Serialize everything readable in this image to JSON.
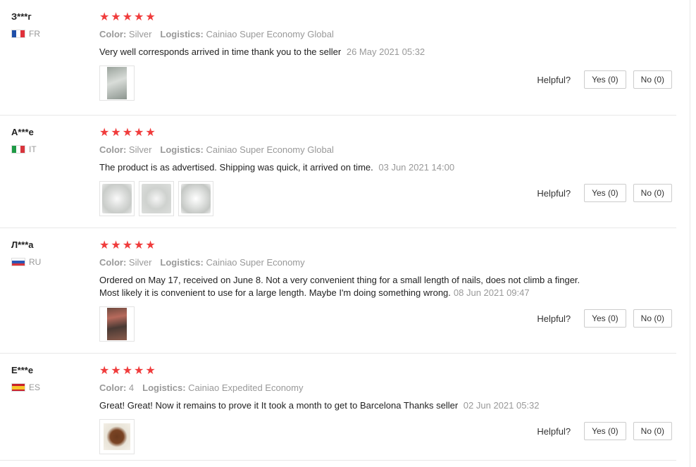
{
  "helpful_label": "Helpful?",
  "color_label": "Color:",
  "logistics_label": "Logistics:",
  "star_glyph": "★",
  "rating_color": "#f03c3c",
  "reviews": [
    {
      "user": "З***г",
      "country": "FR",
      "stars": 5,
      "color": "Silver",
      "logistics": "Cainiao Super Economy Global",
      "text": "Very well corresponds arrived in time thank you to the seller",
      "date": "26 May 2021 05:32",
      "yes": "Yes (0)",
      "no": "No (0)"
    },
    {
      "user": "A***e",
      "country": "IT",
      "stars": 5,
      "color": "Silver",
      "logistics": "Cainiao Super Economy Global",
      "text": "The product is as advertised. Shipping was quick, it arrived on time.",
      "date": "03 Jun 2021 14:00",
      "yes": "Yes (0)",
      "no": "No (0)"
    },
    {
      "user": "Л***а",
      "country": "RU",
      "stars": 5,
      "color": "Silver",
      "logistics": "Cainiao Super Economy",
      "text_line1": "Ordered on May 17, received on June 8. Not a very convenient thing for a small length of nails, does not climb a finger.",
      "text_line2": "Most likely it is convenient to use for a large length. Maybe I'm doing something wrong.",
      "date": "08 Jun 2021 09:47",
      "yes": "Yes (0)",
      "no": "No (0)"
    },
    {
      "user": "E***e",
      "country": "ES",
      "stars": 5,
      "color": "4",
      "logistics": "Cainiao Expedited Economy",
      "text": "Great! Great! Now it remains to prove it It took a month to get to Barcelona Thanks seller",
      "date": "02 Jun 2021 05:32",
      "yes": "Yes (0)",
      "no": "No (0)"
    }
  ]
}
